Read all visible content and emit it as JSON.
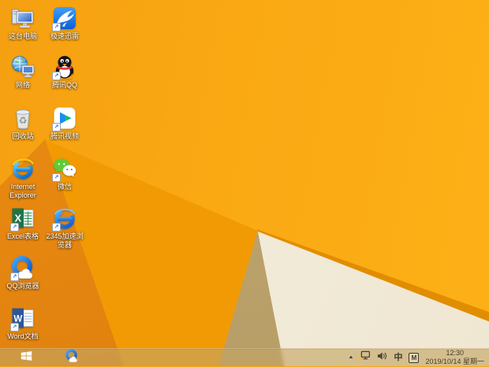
{
  "desktop": {
    "shortcut_glyph": "↗",
    "icons": [
      {
        "name": "this-pc",
        "label": "这台电脑",
        "col": 1,
        "row": 1,
        "shortcut": false
      },
      {
        "name": "xunlei",
        "label": "极速迅雷",
        "col": 2,
        "row": 1,
        "shortcut": true
      },
      {
        "name": "network",
        "label": "网络",
        "col": 1,
        "row": 2,
        "shortcut": false
      },
      {
        "name": "tencent-qq",
        "label": "腾讯QQ",
        "col": 2,
        "row": 2,
        "shortcut": true
      },
      {
        "name": "recycle-bin",
        "label": "回收站",
        "col": 1,
        "row": 3,
        "shortcut": false
      },
      {
        "name": "tencent-video",
        "label": "腾讯视频",
        "col": 2,
        "row": 3,
        "shortcut": true
      },
      {
        "name": "internet-explorer",
        "label": "Internet Explorer",
        "col": 1,
        "row": 4,
        "shortcut": false
      },
      {
        "name": "wechat",
        "label": "微信",
        "col": 2,
        "row": 4,
        "shortcut": true
      },
      {
        "name": "excel",
        "label": "Excel表格",
        "col": 1,
        "row": 5,
        "shortcut": true
      },
      {
        "name": "browser-2345",
        "label": "2345加速浏览器",
        "col": 2,
        "row": 5,
        "shortcut": true
      },
      {
        "name": "qq-browser",
        "label": "QQ浏览器",
        "col": 1,
        "row": 6,
        "shortcut": true
      },
      {
        "name": "word",
        "label": "Word文档",
        "col": 1,
        "row": 7,
        "shortcut": true
      }
    ]
  },
  "taskbar": {
    "pinned": [
      {
        "name": "qq-browser"
      }
    ],
    "tray": {
      "expand_caret": "▲",
      "ime_mode": "中",
      "ime_badge": "M",
      "clock": {
        "time": "12:30",
        "date": "2019/10/14 星期一"
      }
    }
  },
  "colors": {
    "wallpaper_base": "#faa913",
    "wallpaper_deep": "#f29a04",
    "wallpaper_wedge": "#e2830e",
    "wallpaper_cream": "#f2ecd9",
    "wallpaper_tan": "#bda26c",
    "wallpaper_edge": "#e18d02",
    "taskbar_tint": "rgba(195,165,100,0.62)",
    "tray_text": "#473d28"
  }
}
